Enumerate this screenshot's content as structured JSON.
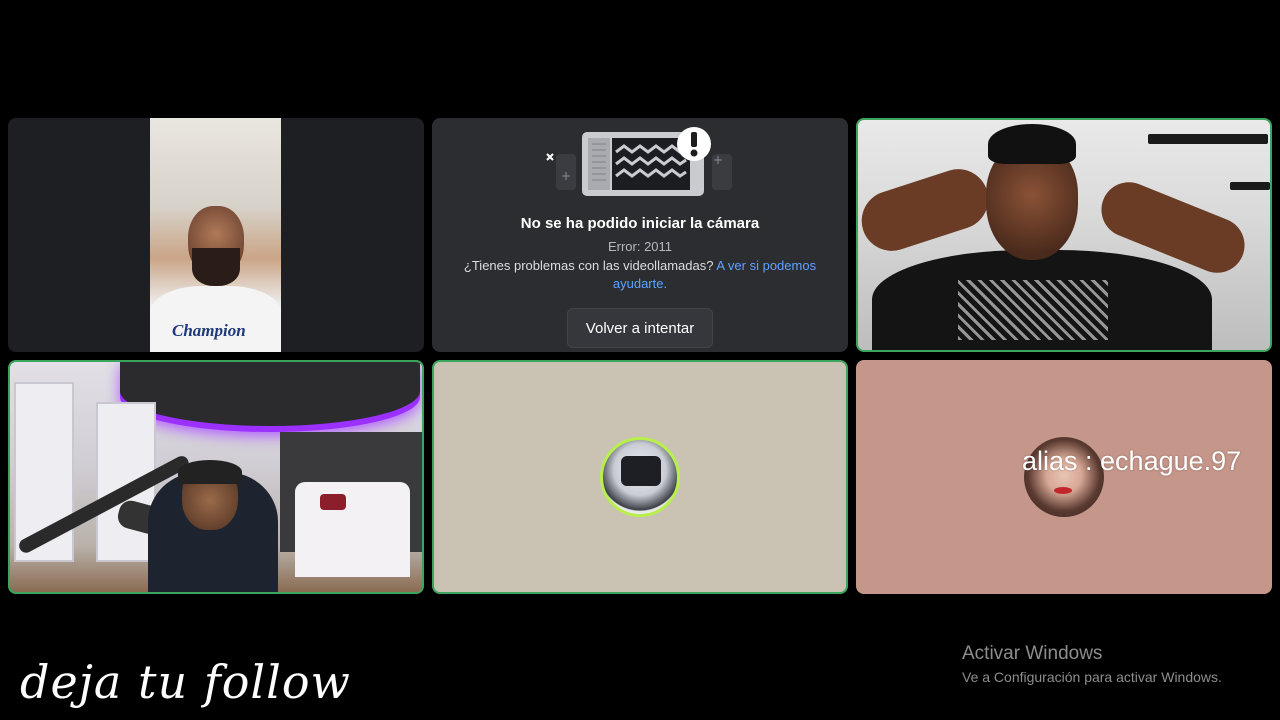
{
  "tiles": {
    "tile1": {
      "shirt_text": "Champion"
    },
    "camera_error": {
      "title": "No se ha podido iniciar la cámara",
      "error": "Error: 2011",
      "help_text": "¿Tienes problemas con las videollamadas?",
      "help_link": "A ver si podemos ayudarte.",
      "retry_button": "Volver a intentar"
    },
    "tile6": {
      "alias": "alias : echague.97"
    }
  },
  "overlay": {
    "follow_text": "deja tu follow"
  },
  "windows_watermark": {
    "title": "Activar Windows",
    "subtitle": "Ve a Configuración para activar Windows."
  },
  "colors": {
    "background": "#000000",
    "tile_bg": "#2b2d31",
    "speaking_border": "#3ba55d",
    "link": "#5ea3ff",
    "tile5_bg": "#cac3b4",
    "tile6_bg": "#c5968a"
  },
  "icons": [
    "camera-broken-icon",
    "exclamation-icon",
    "sparkle-icon"
  ]
}
